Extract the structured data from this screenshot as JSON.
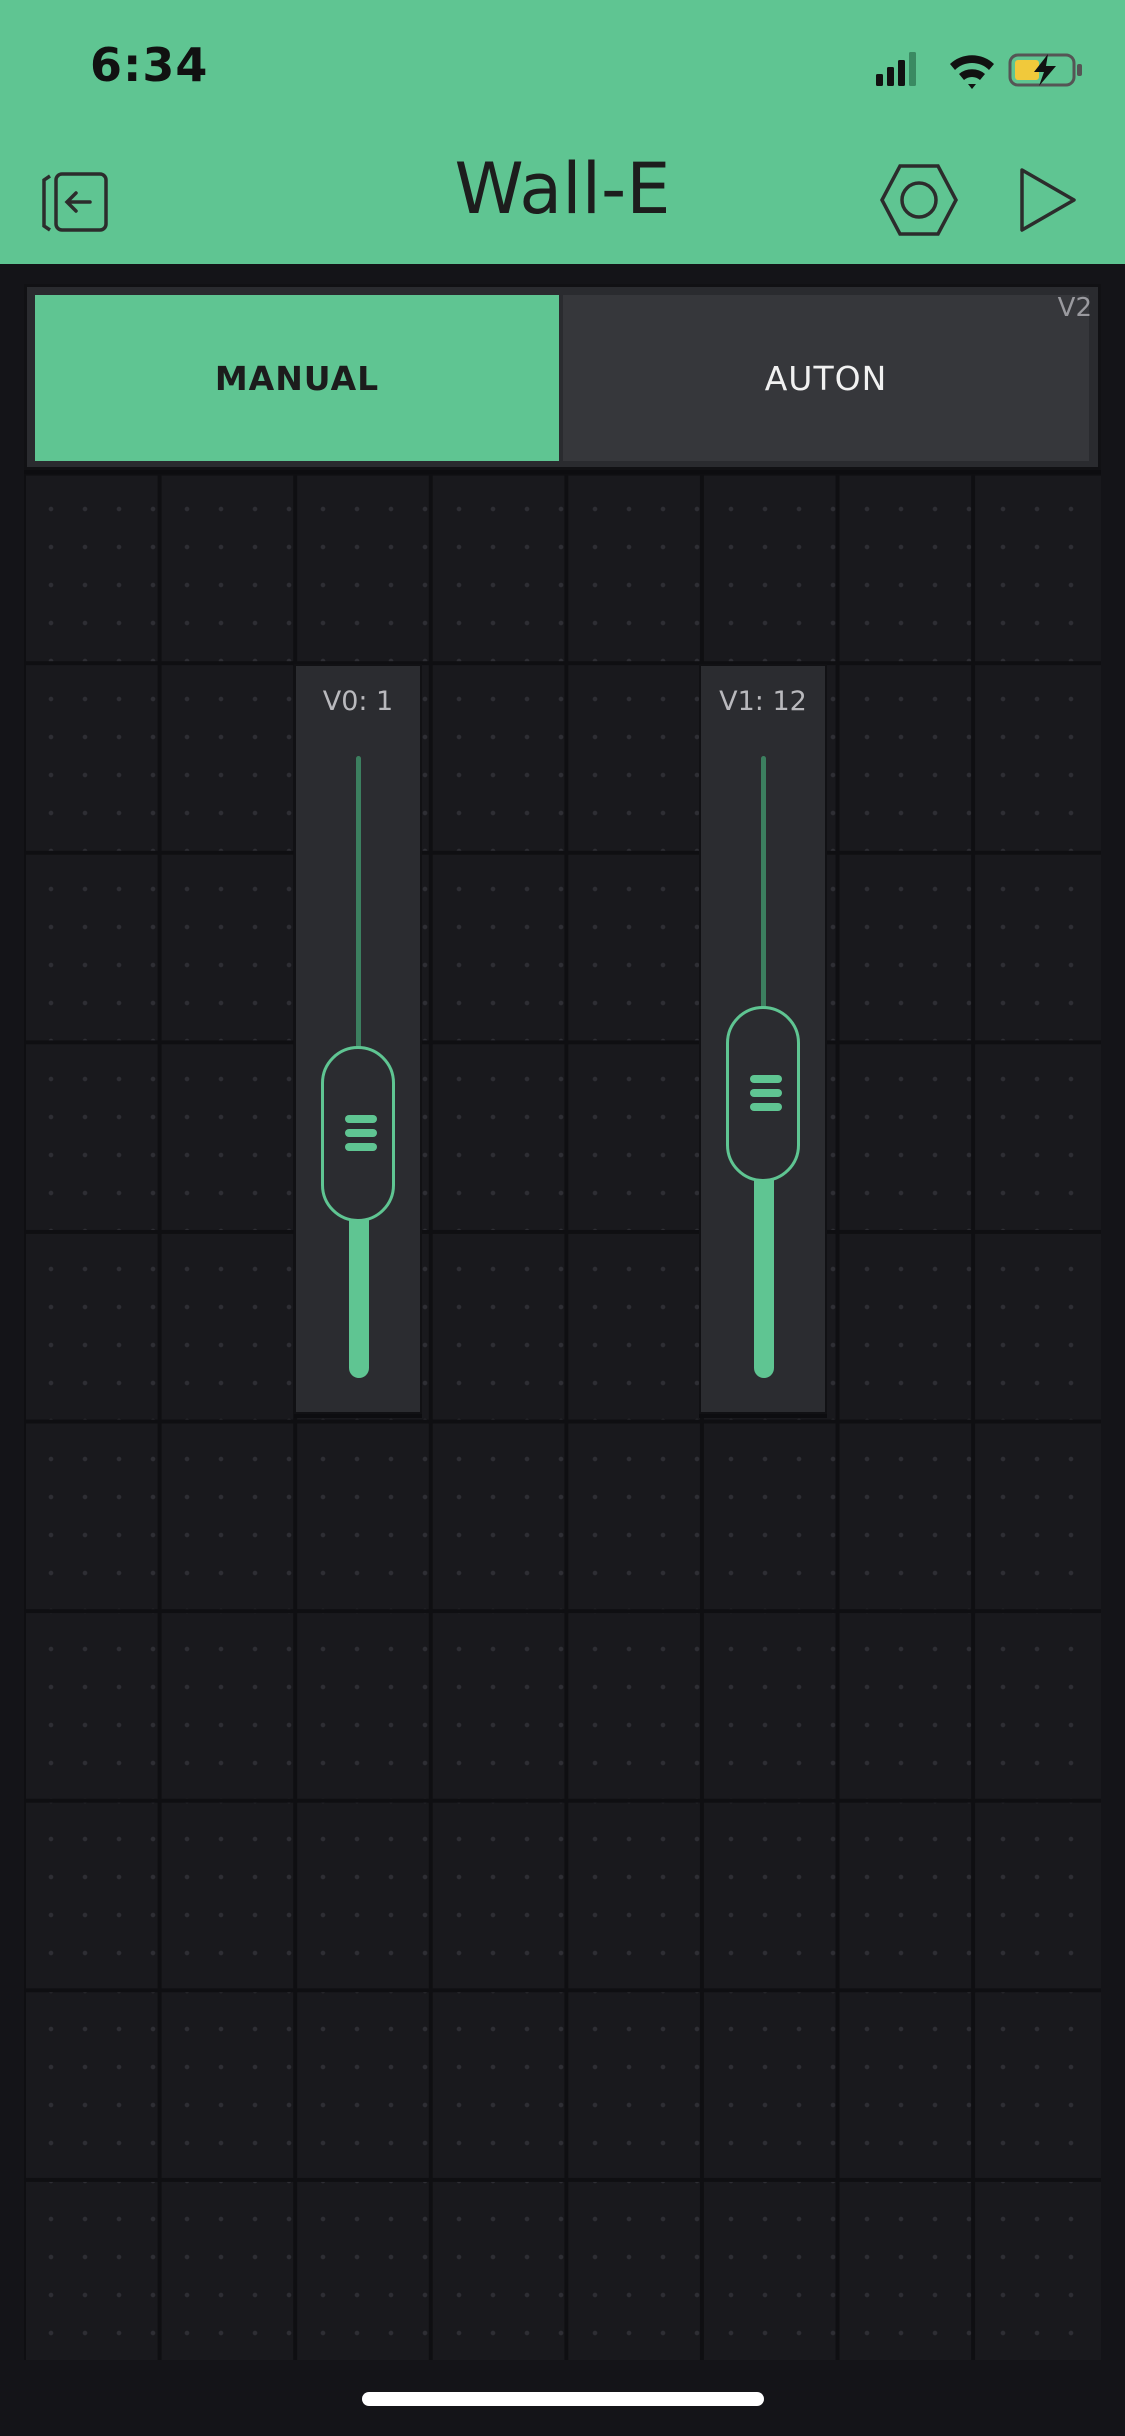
{
  "status_bar": {
    "time": "6:34",
    "signal_icon": "cellular-signal-icon",
    "wifi_icon": "wifi-icon",
    "battery_icon": "battery-charging-icon"
  },
  "header": {
    "title": "Wall-E",
    "left_icon": "exit-icon",
    "settings_icon": "hexagon-nut-icon",
    "play_icon": "play-icon"
  },
  "segmented_switch": {
    "pin": "V2",
    "options": [
      "MANUAL",
      "AUTON"
    ],
    "selected": "MANUAL"
  },
  "sliders": [
    {
      "label": "V0: 1",
      "pin": "V0",
      "value_fraction": 0.35
    },
    {
      "label": "V1: 12",
      "pin": "V1",
      "value_fraction": 0.44
    }
  ],
  "colors": {
    "accent": "#5fc592",
    "background": "#141418",
    "widget": "#2b2c30"
  }
}
